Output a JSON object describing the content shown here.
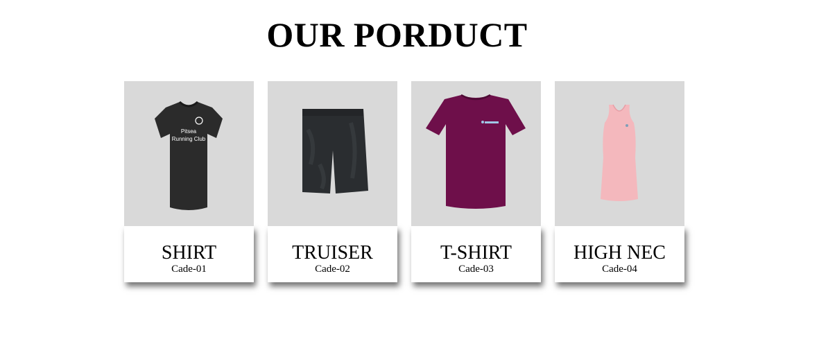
{
  "page": {
    "title": "OUR PORDUCT"
  },
  "products": [
    {
      "name": "SHIRT",
      "code": "Cade-01",
      "image_icon": "black-running-shirt-image",
      "print_line1": "Pitsea",
      "print_line2": "Running Club",
      "color": "#2b2b2b"
    },
    {
      "name": "TRUISER",
      "code": "Cade-02",
      "image_icon": "black-shorts-image",
      "color": "#2a2d30"
    },
    {
      "name": "T-SHIRT",
      "code": "Cade-03",
      "image_icon": "purple-tshirt-image",
      "color": "#6e0f4a"
    },
    {
      "name": "HIGH NEC",
      "code": "Cade-04",
      "image_icon": "pink-tank-top-image",
      "color": "#f4b8bd"
    }
  ]
}
